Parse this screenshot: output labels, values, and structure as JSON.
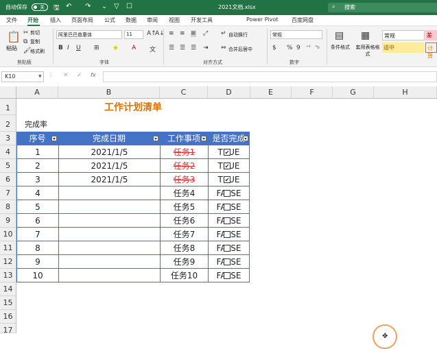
{
  "titlebar": {
    "autosave": "自动保存",
    "toggle": "关",
    "filename": "2021文档.xlsx",
    "search": "搜索"
  },
  "tabs": [
    "文件",
    "开始",
    "插入",
    "页面布局",
    "公式",
    "数据",
    "审阅",
    "视图",
    "开发工具",
    "Power Pivot",
    "百度网盘"
  ],
  "ribbon": {
    "clipboard": {
      "paste": "粘贴",
      "cut": "剪切",
      "copy": "复制",
      "format_painter": "格式刷",
      "label": "剪贴板"
    },
    "font": {
      "name": "阿里巴巴普惠体",
      "size": "11",
      "label": "字体"
    },
    "alignment": {
      "wrap": "自动换行",
      "merge": "合并后居中",
      "label": "对齐方式"
    },
    "number": {
      "format": "常规",
      "label": "数字"
    },
    "styles": {
      "conditional": "条件格式",
      "table": "套用表格格式",
      "normal": "常规",
      "medium": "适中",
      "calc": "计算",
      "bad": "差"
    }
  },
  "formula_bar": {
    "name_box": "K10",
    "fx": "fx",
    "value": ""
  },
  "columns": [
    "A",
    "B",
    "C",
    "D",
    "E",
    "F",
    "G",
    "H"
  ],
  "rows": [
    "1",
    "2",
    "3",
    "4",
    "5",
    "6",
    "7",
    "8",
    "9",
    "10",
    "11",
    "12",
    "13",
    "14",
    "15",
    "16",
    "17"
  ],
  "sheet": {
    "title": "工作计划清单",
    "completion_label": "完成率",
    "headers": [
      "序号",
      "完成日期",
      "工作事项",
      "是否完成"
    ],
    "table": [
      {
        "num": "1",
        "date": "2021/1/5",
        "task": "任务1",
        "done": "TRUE",
        "checked": true
      },
      {
        "num": "2",
        "date": "2021/1/5",
        "task": "任务2",
        "done": "TRUE",
        "checked": true
      },
      {
        "num": "3",
        "date": "2021/1/5",
        "task": "任务3",
        "done": "TRUE",
        "checked": true
      },
      {
        "num": "4",
        "date": "",
        "task": "任务4",
        "done": "FALSE",
        "checked": false
      },
      {
        "num": "5",
        "date": "",
        "task": "任务5",
        "done": "FALSE",
        "checked": false
      },
      {
        "num": "6",
        "date": "",
        "task": "任务6",
        "done": "FALSE",
        "checked": false
      },
      {
        "num": "7",
        "date": "",
        "task": "任务7",
        "done": "FALSE",
        "checked": false
      },
      {
        "num": "8",
        "date": "",
        "task": "任务8",
        "done": "FALSE",
        "checked": false
      },
      {
        "num": "9",
        "date": "",
        "task": "任务9",
        "done": "FALSE",
        "checked": false
      },
      {
        "num": "10",
        "date": "",
        "task": "任务10",
        "done": "FALSE",
        "checked": false
      }
    ]
  },
  "colors": {
    "excel_green": "#217346",
    "header_blue": "#4472c4",
    "title_orange": "#e07000",
    "strike_red": "#e03030"
  }
}
